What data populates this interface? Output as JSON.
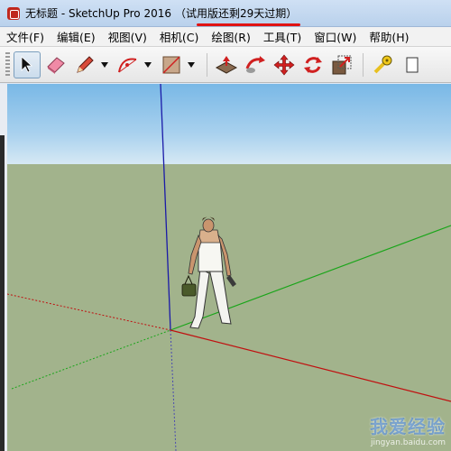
{
  "window": {
    "title": "无标题 - SketchUp Pro 2016",
    "trial_notice": "（试用版还剩29天过期）"
  },
  "menu": {
    "items": [
      "文件(F)",
      "编辑(E)",
      "视图(V)",
      "相机(C)",
      "绘图(R)",
      "工具(T)",
      "窗口(W)",
      "帮助(H)"
    ]
  },
  "toolbar": {
    "tools": [
      "select",
      "eraser",
      "line",
      "arc",
      "rectangle",
      "push-pull",
      "follow-me",
      "move",
      "rotate",
      "scale",
      "tape-measure"
    ]
  },
  "watermark": {
    "text": "我爱经验",
    "sub": "jingyan.baidu.com"
  },
  "colors": {
    "sky": "#a9d1ee",
    "ground": "#a2b38c",
    "axis_red": "#c01010",
    "axis_green": "#1aa51a",
    "axis_blue": "#1a1aa8",
    "title_underline": "#e01212"
  }
}
